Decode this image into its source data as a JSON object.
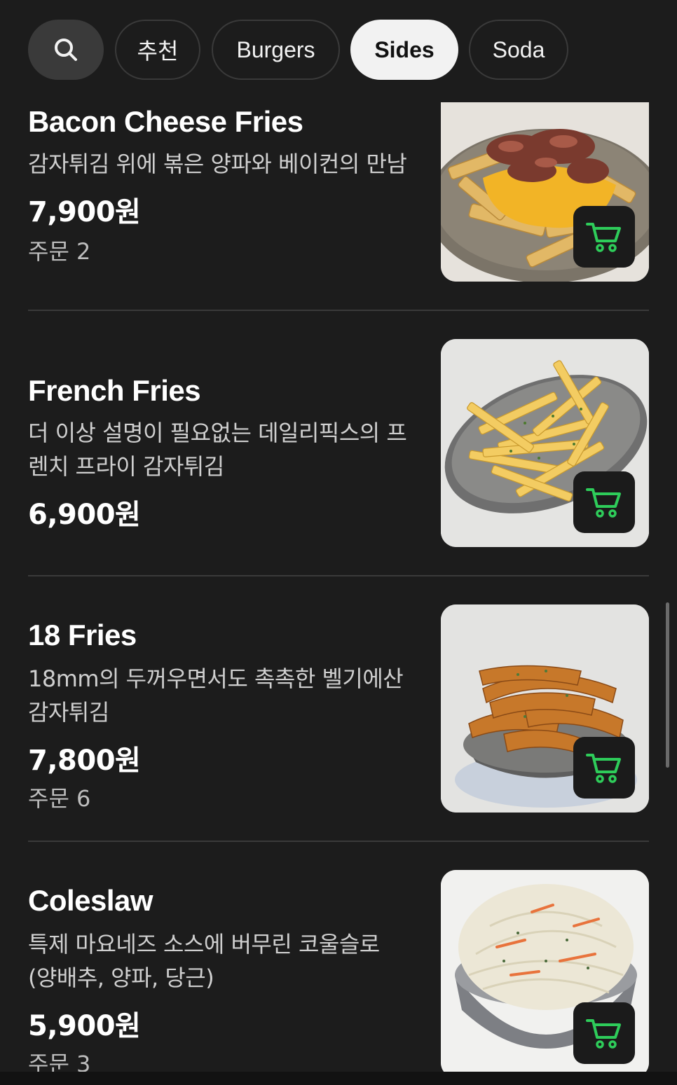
{
  "tabs": [
    {
      "label": "추천",
      "active": false
    },
    {
      "label": "Burgers",
      "active": false
    },
    {
      "label": "Sides",
      "active": true
    },
    {
      "label": "Soda",
      "active": false
    }
  ],
  "colors": {
    "background": "#1c1c1c",
    "chip_border": "#3a3a3a",
    "active_chip": "#f2f2f2",
    "cart_icon": "#2ecc5a",
    "cart_button_bg": "#1b1b1b"
  },
  "icons": {
    "search": "search-icon",
    "cart": "cart-icon"
  },
  "items": [
    {
      "name": "Bacon Cheese Fries",
      "desc": "감자튀김 위에 볶은 양파와 베이컨의 만남",
      "price": "7,900원",
      "orders": "주문 2"
    },
    {
      "name": "French Fries",
      "desc": "더 이상 설명이 필요없는 데일리픽스의 프렌치 프라이 감자튀김",
      "price": "6,900원",
      "orders": ""
    },
    {
      "name": "18 Fries",
      "desc": "18mm의 두꺼우면서도 촉촉한 벨기에산 감자튀김",
      "price": "7,800원",
      "orders": "주문 6"
    },
    {
      "name": "Coleslaw",
      "desc": "특제 마요네즈 소스에 버무린 코울슬로 (양배추, 양파, 당근)",
      "price": "5,900원",
      "orders": "주문 3"
    }
  ]
}
